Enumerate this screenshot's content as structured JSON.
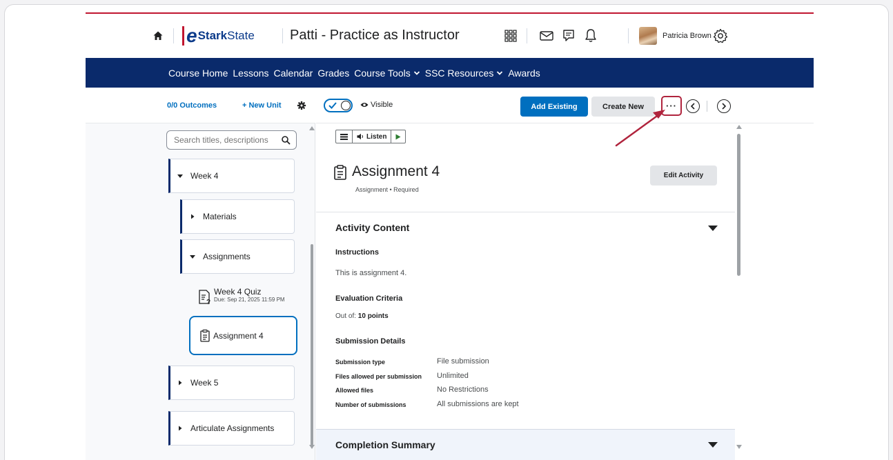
{
  "header": {
    "logo": {
      "e": "e",
      "stark": "Stark",
      "state": "State"
    },
    "course_title": "Patti - Practice as Instructor",
    "user_name": "Patricia Brown"
  },
  "nav": {
    "items": [
      {
        "label": "Course Home",
        "dropdown": false
      },
      {
        "label": "Lessons",
        "dropdown": false
      },
      {
        "label": "Calendar",
        "dropdown": false
      },
      {
        "label": "Grades",
        "dropdown": false
      },
      {
        "label": "Course Tools",
        "dropdown": true
      },
      {
        "label": "SSC Resources",
        "dropdown": true
      },
      {
        "label": "Awards",
        "dropdown": false
      }
    ]
  },
  "left": {
    "outcomes": "0/0 Outcomes",
    "new_unit": "+ New Unit",
    "search_placeholder": "Search titles, descriptions",
    "tree": {
      "week4": "Week 4",
      "materials": "Materials",
      "assignments": "Assignments",
      "quiz_title": "Week 4 Quiz",
      "quiz_due": "Due: Sep 21, 2025 11:59 PM",
      "selected": "Assignment 4",
      "week5": "Week 5",
      "articulate": "Articulate Assignments"
    }
  },
  "toolbar": {
    "visible": "Visible",
    "add_existing": "Add Existing",
    "create_new": "Create New",
    "more": "···"
  },
  "content": {
    "listen": "Listen",
    "title": "Assignment 4",
    "subtitle": "Assignment • Required",
    "edit_activity": "Edit Activity",
    "activity_content": "Activity Content",
    "instructions_label": "Instructions",
    "instructions_text": "This is assignment 4.",
    "eval_label": "Evaluation Criteria",
    "out_of_prefix": "Out of:",
    "out_of_value": "10 points",
    "submission_label": "Submission Details",
    "details": [
      {
        "k": "Submission type",
        "v": "File submission"
      },
      {
        "k": "Files allowed per submission",
        "v": "Unlimited"
      },
      {
        "k": "Allowed files",
        "v": "No Restrictions"
      },
      {
        "k": "Number of submissions",
        "v": "All submissions are kept"
      }
    ],
    "completion_summary": "Completion Summary"
  },
  "colors": {
    "brand_navy": "#0a2a6b",
    "primary_blue": "#006fbf",
    "accent_red": "#c0152f",
    "highlight_red": "#b0243d"
  }
}
